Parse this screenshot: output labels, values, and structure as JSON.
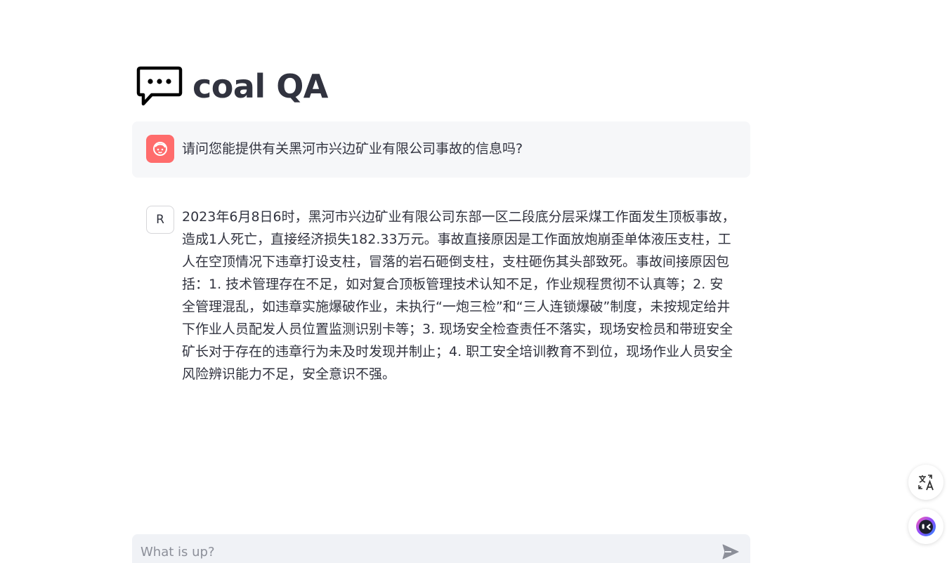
{
  "header": {
    "title": "coal QA",
    "title_icon": "speech-bubble-icon"
  },
  "messages": [
    {
      "role": "user",
      "avatar_icon": "user-face-icon",
      "avatar_color": "#ff6c6c",
      "text": "请问您能提供有关黑河市兴边矿业有限公司事故的信息吗?"
    },
    {
      "role": "assistant",
      "avatar_letter": "R",
      "text": "2023年6月8日6时，黑河市兴边矿业有限公司东部一区二段底分层采煤工作面发生顶板事故，造成1人死亡，直接经济损失182.33万元。事故直接原因是工作面放炮崩歪单体液压支柱，工人在空顶情况下违章打设支柱，冒落的岩石砸倒支柱，支柱砸伤其头部致死。事故间接原因包括：1. 技术管理存在不足，如对复合顶板管理技术认知不足，作业规程贯彻不认真等；2. 安全管理混乱，如违章实施爆破作业，未执行“一炮三检”和“三人连锁爆破”制度，未按规定给井下作业人员配发人员位置监测识别卡等；3. 现场安全检查责任不落实，现场安检员和带班安全矿长对于存在的违章行为未及时发现并制止；4. 职工安全培训教育不到位，现场作业人员安全风险辨识能力不足，安全意识不强。"
    }
  ],
  "chat_input": {
    "placeholder": "What is up?",
    "value": "",
    "send_icon": "send-icon"
  },
  "floating": {
    "translate_icon": "translate-icon",
    "assistant_icon": "assistant-face-icon"
  },
  "colors": {
    "text": "#31333f",
    "user_bg": "#f6f7f9",
    "input_bg": "#f0f2f6",
    "user_avatar": "#ff6c6c"
  }
}
